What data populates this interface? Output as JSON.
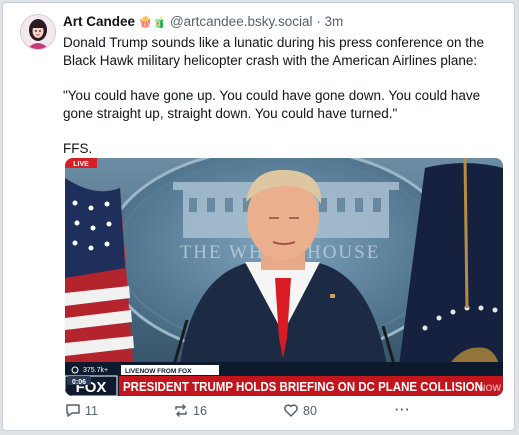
{
  "post": {
    "author_name": "Art Candee",
    "author_emojis": "🍿🧃",
    "handle": "@artcandee.bsky.social",
    "separator": "·",
    "time": "3m",
    "paragraphs": [
      "Donald Trump sounds like a lunatic during his press conference on the Black Hawk military helicopter crash with the American Airlines plane:",
      "\"You could have gone up. You could have gone down. You could have gone straight up, straight down. You could have turned.\"",
      "FFS."
    ]
  },
  "video": {
    "live_badge": "LIVE",
    "backdrop_text": "THE WHITE HOUSE",
    "viewer_count": "375.7k+",
    "network_tag": "LIVENOW FROM FOX",
    "network_logo": "FOX",
    "clock": "0:06",
    "headline": "PRESIDENT TRUMP HOLDS BRIEFING ON DC PLANE COLLISION",
    "corner_bug": "NOW"
  },
  "actions": {
    "replies": "11",
    "reposts": "16",
    "likes": "80",
    "more": "···"
  },
  "colors": {
    "text": "#0f1419",
    "muted": "#55616e",
    "lower_third_red": "#c2161c",
    "live_red": "#d51f26"
  },
  "icons": [
    "avatar-illustration",
    "reply-icon",
    "repost-icon",
    "like-icon",
    "more-icon"
  ]
}
